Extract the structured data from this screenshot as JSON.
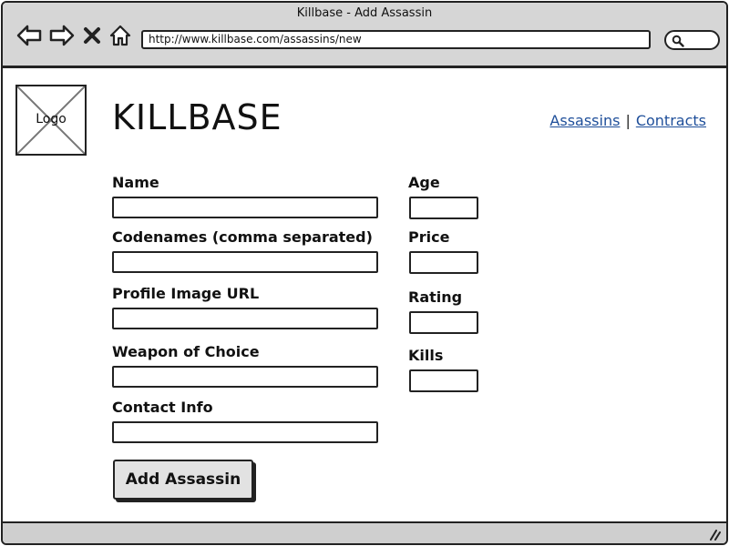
{
  "window": {
    "title": "Killbase - Add Assassin"
  },
  "browser": {
    "url": "http://www.killbase.com/assassins/new",
    "icons": [
      "back-arrow-icon",
      "forward-arrow-icon",
      "close-x-icon",
      "home-icon",
      "search-icon"
    ]
  },
  "header": {
    "logo_label": "Logo",
    "brand": "KILLBASE",
    "links": {
      "assassins": "Assassins",
      "separator": "|",
      "contracts": "Contracts"
    }
  },
  "form": {
    "name_label": "Name",
    "codenames_label": "Codenames (comma separated)",
    "profile_image_label": "Profile Image URL",
    "weapon_label": "Weapon of Choice",
    "contact_label": "Contact Info",
    "age_label": "Age",
    "price_label": "Price",
    "rating_label": "Rating",
    "kills_label": "Kills",
    "name_value": "",
    "codenames_value": "",
    "profile_image_value": "",
    "weapon_value": "",
    "contact_value": "",
    "age_value": "",
    "price_value": "",
    "rating_value": "",
    "kills_value": "",
    "submit_label": "Add Assassin"
  },
  "colors": {
    "chrome": "#d6d6d6",
    "link": "#1f4f9a",
    "button": "#e2e2e2",
    "outline": "#222222"
  }
}
